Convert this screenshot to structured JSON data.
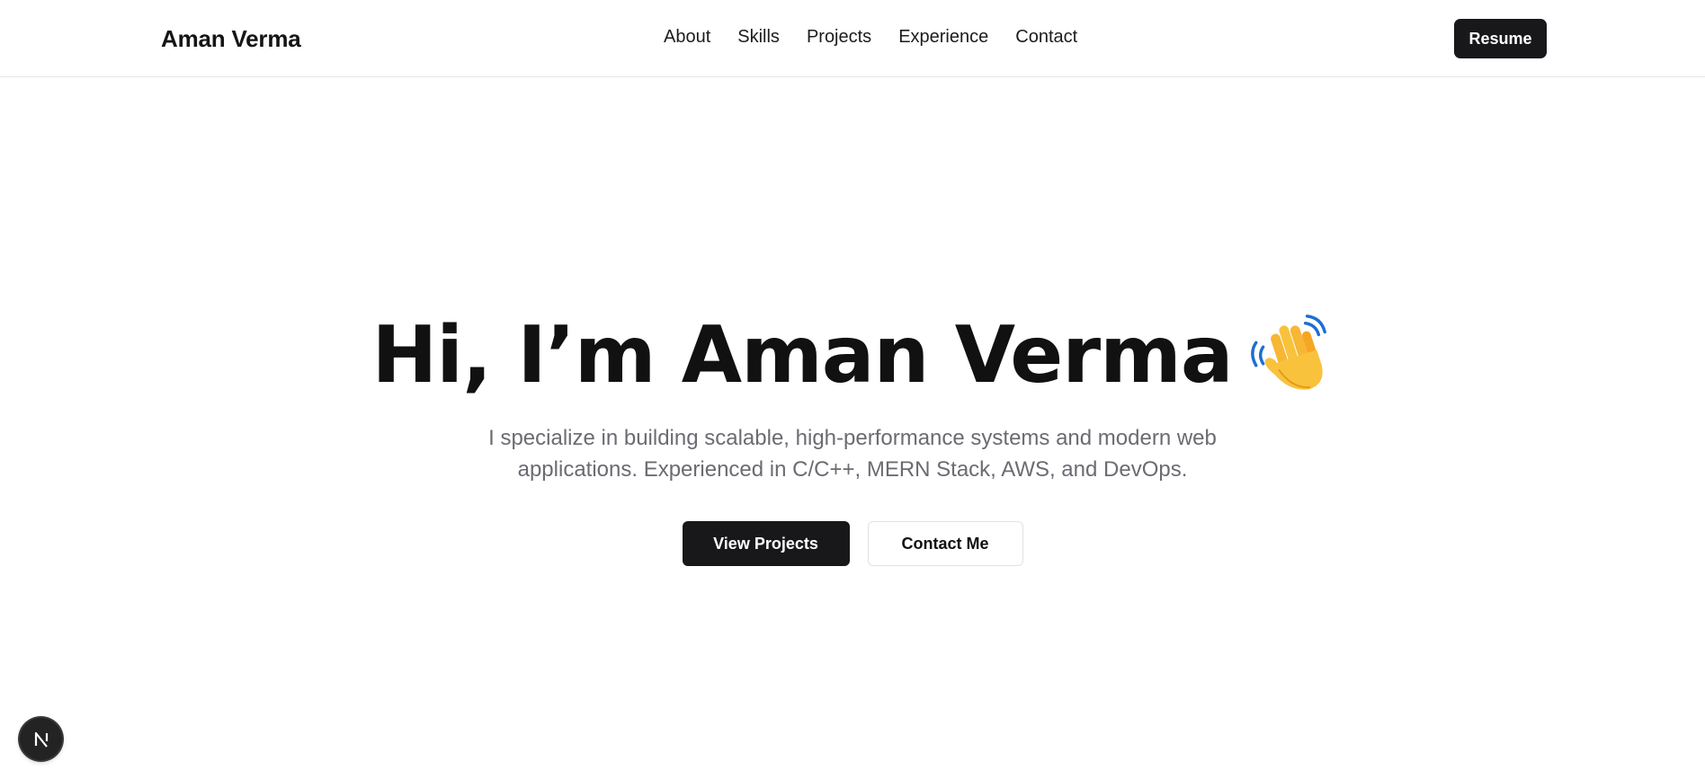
{
  "nav": {
    "brand": "Aman Verma",
    "links": [
      "About",
      "Skills",
      "Projects",
      "Experience",
      "Contact"
    ],
    "resume_label": "Resume"
  },
  "hero": {
    "title": "Hi, I’m Aman Verma",
    "title_icon": "waving-hand-icon",
    "subtitle": "I specialize in building scalable, high-performance systems and modern web applications. Experienced in C/C++, MERN Stack, AWS, and DevOps.",
    "primary_cta": "View Projects",
    "secondary_cta": "Contact Me"
  },
  "dev_badge": {
    "icon": "nextjs-icon"
  },
  "colors": {
    "primary": "#18181b",
    "muted_text": "#6b6b73",
    "border": "#e6e6e6",
    "background": "#ffffff"
  }
}
